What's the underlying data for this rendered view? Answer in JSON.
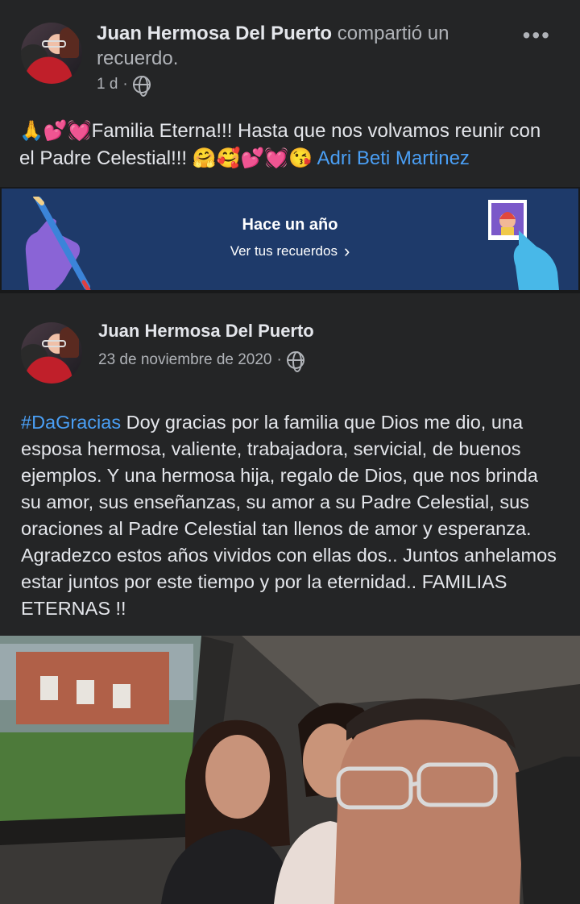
{
  "shared_post": {
    "author": "Juan Hermosa Del Puerto",
    "action": " compartió un recuerdo.",
    "time": "1 d",
    "separator": "·",
    "more": "•••",
    "caption_prefix": "🙏💕💓Familia Eterna!!! Hasta que nos volvamos reunir con el Padre Celestial!!! 🤗🥰💕💓😘 ",
    "caption_mention": "Adri Beti Martinez"
  },
  "memory_banner": {
    "title": "Hace un año",
    "link": "Ver tus recuerdos",
    "chevron": "›"
  },
  "original_post": {
    "author": "Juan Hermosa Del Puerto",
    "date": "23 de noviembre de 2020",
    "separator": "·",
    "hashtag": "#DaGracias",
    "body": " Doy gracias por la familia que Dios me dio, una esposa hermosa, valiente, trabajadora, servicial, de buenos ejemplos. Y una hermosa hija, regalo de Dios, que nos brinda su amor, sus enseñanzas, su amor a su Padre Celestial,  sus oraciones al Padre Celestial tan llenos de amor y esperanza.   Agradezco estos años vividos con ellas dos.. Juntos anhelamos estar juntos por este tiempo y por la eternidad.. FAMILIAS ETERNAS !!"
  },
  "icons": [
    "globe-icon",
    "more-options-icon",
    "chevron-right-icon"
  ],
  "colors": {
    "background": "#18191a",
    "card": "#242526",
    "banner": "#1e3a6a",
    "link": "#4a9ff5",
    "text": "#e4e6eb",
    "secondary_text": "#b0b3b8"
  }
}
